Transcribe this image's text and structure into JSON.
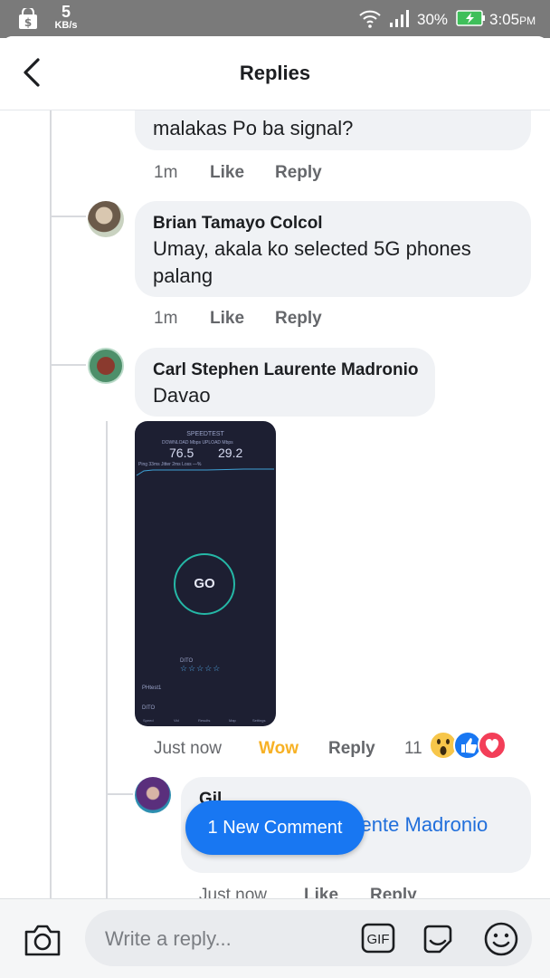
{
  "status_bar": {
    "speed_value": "5",
    "speed_unit": "KB/s",
    "battery": "30%",
    "time": "3:05",
    "ampm": "PM"
  },
  "header": {
    "title": "Replies"
  },
  "comments": [
    {
      "text": "malakas Po ba signal?",
      "time": "1m",
      "like": "Like",
      "reply": "Reply"
    },
    {
      "author": "Brian Tamayo Colcol",
      "text_line1": "Umay, akala ko selected 5G phones",
      "text_line2": "palang",
      "time": "1m",
      "like": "Like",
      "reply": "Reply"
    },
    {
      "author": "Carl Stephen Laurente Madronio",
      "text": "Davao",
      "time": "Just now",
      "reaction": "Wow",
      "reply": "Reply",
      "reaction_count": "11"
    }
  ],
  "attachment": {
    "title": "SPEEDTEST",
    "labels": "DOWNLOAD Mbps      UPLOAD Mbps",
    "download": "76.5",
    "upload": "29.2",
    "ping_row": "Ping 33ms        Jitter 2ms        Loss —%",
    "go": "GO",
    "provider": "DITO",
    "stars": "☆☆☆☆☆",
    "server": "PHtest1",
    "carrier": "DITO",
    "nav": [
      "Speed",
      "Vid",
      "Results",
      "Map",
      "Settings"
    ]
  },
  "nested_reply": {
    "author": "Gil",
    "mention": "Carl Stephen Laurente Madronio",
    "time": "Just now",
    "like": "Like",
    "reply": "Reply"
  },
  "new_comment_pill": "1 New Comment",
  "composer": {
    "placeholder": "Write a reply...",
    "gif": "GIF"
  },
  "colors": {
    "link": "#216fdb",
    "wow": "#f7b125",
    "pill": "#1877f2",
    "status_bar": "#7a7a7a"
  },
  "icons": [
    "shopping-bag-icon",
    "wifi-icon",
    "signal-icon",
    "battery-charging-icon",
    "back-arrow-icon",
    "camera-icon",
    "gif-icon",
    "sticker-icon",
    "emoji-icon",
    "wow-reaction-icon",
    "like-reaction-icon",
    "love-reaction-icon"
  ]
}
